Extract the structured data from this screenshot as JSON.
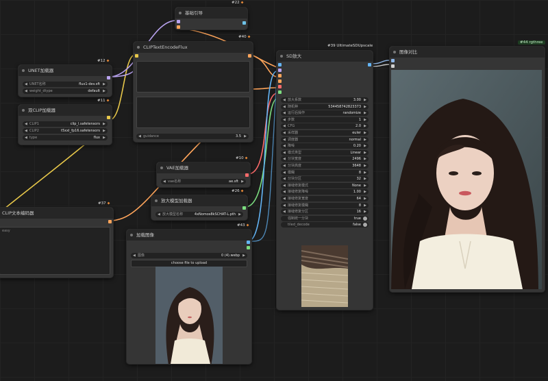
{
  "nodes": {
    "n22": {
      "badge": "#22",
      "title": "基础引导"
    },
    "n40": {
      "badge": "#40",
      "title": "CLIPTextEncodeFlux",
      "guidance_label": "guidance",
      "guidance_value": "3.5"
    },
    "n12": {
      "badge": "#12",
      "title": "UNET加载器",
      "unet_label": "UNET名称",
      "unet_value": "flux1-dev.sft",
      "dtype_label": "weight_dtype",
      "dtype_value": "default"
    },
    "n11": {
      "badge": "#11",
      "title": "双CLIP加载器",
      "clip1_label": "CLIP1",
      "clip1_value": "clip_l.safetensors",
      "clip2_label": "CLIP2",
      "clip2_value": "t5xxl_fp16.safetensors",
      "type_label": "type",
      "type_value": "flux"
    },
    "n10": {
      "badge": "#10",
      "title": "VAE加载器",
      "vae_label": "vae名称",
      "vae_value": "ae.sft"
    },
    "n26": {
      "badge": "#26",
      "title": "放大模型加载器",
      "model_label": "放大模型名称",
      "model_value": "4xNomos8kSCHAT-L.pth"
    },
    "n37": {
      "badge": "#37",
      "title": "CLIP文本编码器",
      "text_placeholder": "easy"
    },
    "n43": {
      "badge": "#43",
      "title": "加载图像",
      "image_label": "图像",
      "image_value": "0 (4).webp",
      "upload_label": "choose file to upload"
    },
    "n39": {
      "badge": "#39 UltimateSDUpscale",
      "title": "SD放大",
      "params": [
        {
          "label": "放大系数",
          "value": "3.00"
        },
        {
          "label": "随机种",
          "value": "534458742823373"
        },
        {
          "label": "运行后操作",
          "value": "randomize"
        },
        {
          "label": "步数",
          "value": "1"
        },
        {
          "label": "CFG",
          "value": "2.0"
        },
        {
          "label": "采样器",
          "value": "euler"
        },
        {
          "label": "调度器",
          "value": "normal"
        },
        {
          "label": "降噪",
          "value": "0.20"
        },
        {
          "label": "模式类型",
          "value": "Linear"
        },
        {
          "label": "分块宽度",
          "value": "2496"
        },
        {
          "label": "分块高度",
          "value": "3648"
        },
        {
          "label": "模糊",
          "value": "8"
        },
        {
          "label": "分块分区",
          "value": "32"
        },
        {
          "label": "接缝修复模式",
          "value": "None"
        },
        {
          "label": "接缝修复降噪",
          "value": "1.00"
        },
        {
          "label": "接缝修复宽度",
          "value": "64"
        },
        {
          "label": "接缝修复模糊",
          "value": "8"
        },
        {
          "label": "接缝修复分区",
          "value": "16"
        },
        {
          "label": "强制统一分块",
          "value": "true"
        },
        {
          "label": "tiled_decode",
          "value": "false"
        }
      ]
    },
    "n44": {
      "badge": "#44 rgthree",
      "title": "图像对比"
    }
  },
  "colors": {
    "link_clip": "#e8c84a",
    "link_model": "#b9a3f0",
    "link_vae": "#ff6b6b",
    "link_image": "#64b5f6",
    "link_upscale": "#7cde80",
    "link_cond": "#ffa55b",
    "canvas": "#1c1c1c",
    "node": "#353535"
  }
}
